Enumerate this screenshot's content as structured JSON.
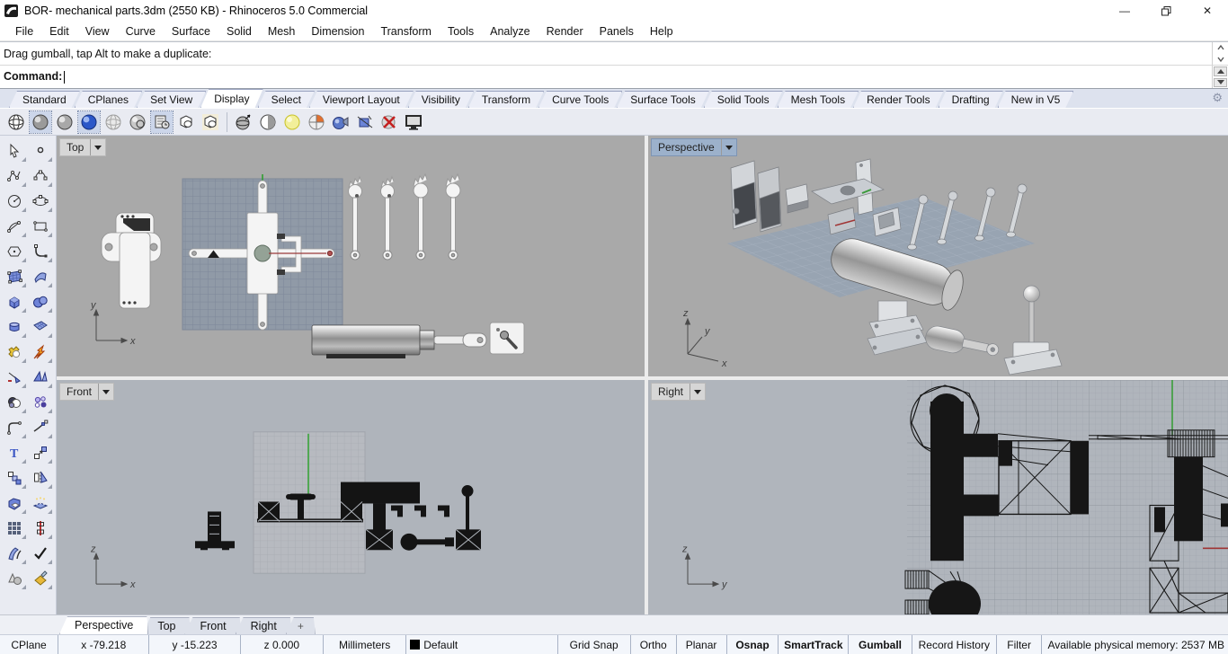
{
  "window": {
    "title": "BOR- mechanical parts.3dm (2550 KB) - Rhinoceros 5.0 Commercial"
  },
  "icons": {
    "minimize": "—",
    "close": "✕",
    "gear": "⚙",
    "plus_tab": "+"
  },
  "menu": {
    "items": [
      "File",
      "Edit",
      "View",
      "Curve",
      "Surface",
      "Solid",
      "Mesh",
      "Dimension",
      "Transform",
      "Tools",
      "Analyze",
      "Render",
      "Panels",
      "Help"
    ]
  },
  "command": {
    "history": "Drag gumball, tap Alt to make a duplicate:",
    "prompt": "Command:"
  },
  "toolbar_tabs": {
    "active": "Display",
    "items": [
      "Standard",
      "CPlanes",
      "Set View",
      "Display",
      "Select",
      "Viewport Layout",
      "Visibility",
      "Transform",
      "Curve Tools",
      "Surface Tools",
      "Solid Tools",
      "Mesh Tools",
      "Render Tools",
      "Drafting",
      "New in V5"
    ]
  },
  "viewports": {
    "top": {
      "label": "Top",
      "axis_h": "x",
      "axis_v": "y"
    },
    "perspective": {
      "label": "Perspective",
      "axis_h": "x",
      "axis_v": "z",
      "axis_d": "y"
    },
    "front": {
      "label": "Front",
      "axis_h": "x",
      "axis_v": "z"
    },
    "right": {
      "label": "Right",
      "axis_h": "y",
      "axis_v": "z"
    }
  },
  "viewport_tabs": {
    "active": "Perspective",
    "items": [
      "Perspective",
      "Top",
      "Front",
      "Right"
    ]
  },
  "status_bar": {
    "cplane": "CPlane",
    "x": "x -79.218",
    "y": "y -15.223",
    "z": "z 0.000",
    "units": "Millimeters",
    "layer": "Default",
    "toggles": [
      {
        "label": "Grid Snap",
        "active": false
      },
      {
        "label": "Ortho",
        "active": false
      },
      {
        "label": "Planar",
        "active": false
      },
      {
        "label": "Osnap",
        "active": true
      },
      {
        "label": "SmartTrack",
        "active": true
      },
      {
        "label": "Gumball",
        "active": true
      },
      {
        "label": "Record History",
        "active": false
      },
      {
        "label": "Filter",
        "active": false
      }
    ],
    "memory": "Available physical memory: 2537 MB"
  },
  "colors": {
    "viewport_top_bg": "#a9a9a9",
    "viewport_bottom_bg": "#afb4bb",
    "grid_blue": "#909aa7",
    "active_label_bg": "#9cb1cb",
    "axis_green": "#2f9e2f",
    "centerline_red": "#9a3a3a"
  }
}
